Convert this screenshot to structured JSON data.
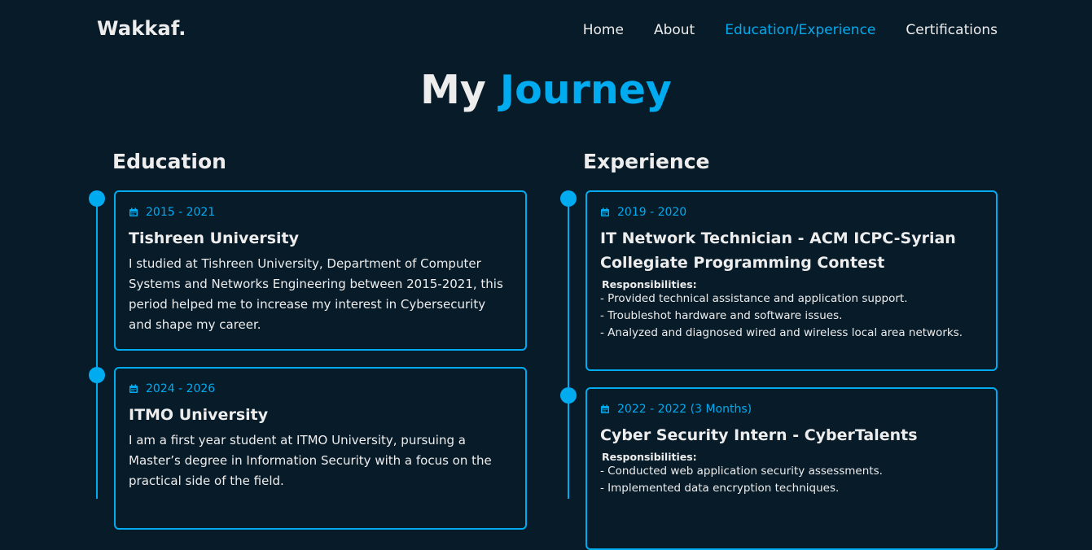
{
  "header": {
    "logo": "Wakkaf.",
    "nav": [
      "Home",
      "About",
      "Education/Experience",
      "Certifications"
    ],
    "active_index": 2
  },
  "heading": {
    "part1": "My ",
    "part2": "Journey"
  },
  "education": {
    "title": "Education",
    "items": [
      {
        "years": "2015 - 2021",
        "name": "Tishreen University",
        "text": "I studied at Tishreen University, Department of Computer Systems and Networks Engineering between 2015-2021, this period helped me to increase my interest in Cybersecurity and shape my career."
      },
      {
        "years": "2024 - 2026",
        "name": "ITMO University",
        "text": "I am a first year student at ITMO University, pursuing a Master’s degree in Information Security with a focus on the practical side of the field."
      }
    ]
  },
  "experience": {
    "title": "Experience",
    "items": [
      {
        "years": "2019 - 2020",
        "role": "IT Network Technician - ACM ICPC-Syrian Collegiate Programming Contest",
        "resp_label": "Responsibilities:",
        "resp": [
          "- Provided technical assistance and application support.",
          "- Troubleshot hardware and software issues.",
          "- Analyzed and diagnosed wired and wireless local area networks."
        ]
      },
      {
        "years": "2022 - 2022 (3 Months)",
        "role": "Cyber Security Intern - CyberTalents",
        "resp_label": "Responsibilities:",
        "resp": [
          "- Conducted web application security assessments.",
          "- Implemented data encryption techniques."
        ]
      }
    ]
  },
  "colors": {
    "background": "#081b29",
    "accent": "#00abf0",
    "text": "#ededed"
  },
  "icons": {
    "year_icon": "calendar-icon"
  }
}
